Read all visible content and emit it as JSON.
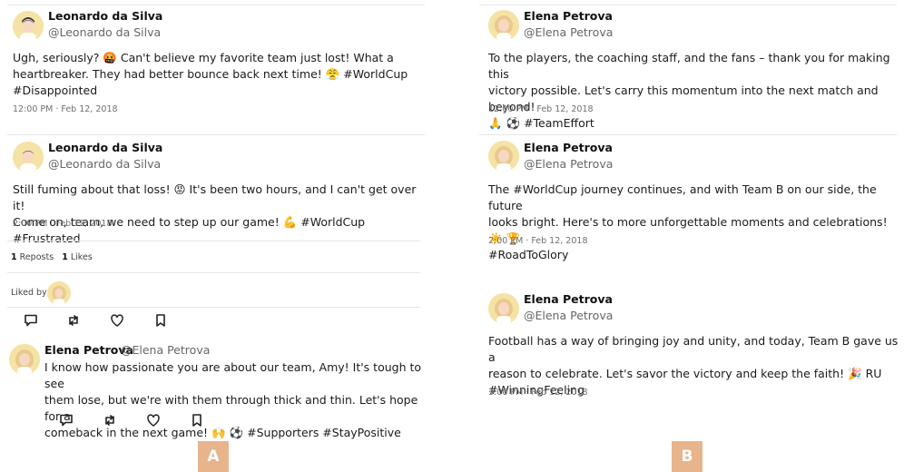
{
  "panel_a": {
    "badge": "A",
    "tweet1": {
      "name": "Leonardo da Silva",
      "handle": "@Leonardo da Silva",
      "text_line1": "Ugh, seriously? 🤬 Can't believe my favorite team just lost! What a",
      "text_line2": "heartbreaker. They had better bounce back next time! 😤 #WorldCup",
      "text_line3": "#Disappointed",
      "time": "12:00 PM · Feb 12, 2018"
    },
    "tweet2": {
      "name": "Leonardo da Silva",
      "handle": "@Leonardo da Silva",
      "text_line1": "Still fuming about that loss! 😡 It's been two hours, and I can't get over it!",
      "text_line2": "Come on, team, we need to step up our game! 💪 #WorldCup #Frustrated",
      "time": "2:00 PM · Feb 12, 2018",
      "reposts_count": "1",
      "reposts_label": "Reposts",
      "likes_count": "1",
      "likes_label": "Likes",
      "liked_by_label": "Liked by"
    },
    "reply": {
      "name": "Elena Petrova",
      "handle": "@Elena Petrova",
      "text_line1": "I know how passionate you are about our team, Amy! It's tough to see",
      "text_line2": "them lose, but we're with them through thick and thin. Let's hope for a",
      "text_line3": "comeback in the next game! 🙌 ⚽ #Supporters #StayPositive"
    },
    "actions": [
      "reply-icon",
      "repost-icon",
      "like-icon",
      "bookmark-icon"
    ]
  },
  "panel_b": {
    "badge": "B",
    "tweet1": {
      "name": "Elena Petrova",
      "handle": "@Elena Petrova",
      "text_line1": "To the players, the coaching staff, and the fans – thank you for making this",
      "text_line2": "victory possible. Let's carry this momentum into the next match and beyond!",
      "text_line3": "🙏 ⚽ #TeamEffort",
      "time": "12:00 PM · Feb 12, 2018"
    },
    "tweet2": {
      "name": "Elena Petrova",
      "handle": "@Elena Petrova",
      "text_line1": "The #WorldCup journey continues, and with Team B on our side, the future",
      "text_line2": "looks bright. Here's to more unforgettable moments and celebrations! ☀️ 🏆",
      "text_line3": "#RoadToGlory",
      "time": "2:00 PM · Feb 12, 2018"
    },
    "tweet3": {
      "name": "Elena Petrova",
      "handle": "@Elena Petrova",
      "text_line1": "Football has a way of bringing joy and unity, and today, Team B gave us a",
      "text_line2": "reason to celebrate. Let's savor the victory and keep the faith! 🎉 RU",
      "text_line3": "#WinningFeeling",
      "time": "3:00 PM · Feb 12, 2018"
    }
  },
  "colors": {
    "badge": "#e8b48c",
    "avatar_bg": "#f5e3a6",
    "divider": "#e6e6e6",
    "muted_text": "#666666"
  }
}
